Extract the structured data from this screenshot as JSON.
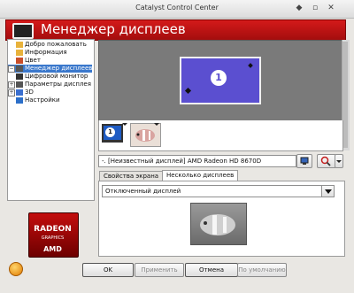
{
  "window": {
    "title": "Catalyst Control Center",
    "buttons": [
      "◆",
      "▫",
      "✕"
    ]
  },
  "header": {
    "title": "Менеджер дисплеев"
  },
  "tree": {
    "items": [
      {
        "label": "Добро пожаловать",
        "toggle": "",
        "icon_color": "#e8b23b"
      },
      {
        "label": "Информация",
        "toggle": "",
        "icon_color": "#e8b23b"
      },
      {
        "label": "Цвет",
        "toggle": "",
        "icon_color": "#c94e2a"
      },
      {
        "label": "Менеджер дисплеев",
        "toggle": "−",
        "icon_color": "#555555",
        "selected": true
      },
      {
        "label": "Цифровой монитор",
        "toggle": "",
        "icon_color": "#333333"
      },
      {
        "label": "Параметры дисплея",
        "toggle": "+",
        "icon_color": "#555555"
      },
      {
        "label": "3D",
        "toggle": "+",
        "icon_color": "#3a6fd0"
      },
      {
        "label": "Настройки",
        "toggle": "",
        "icon_color": "#2c6fc9"
      }
    ]
  },
  "amd": {
    "line1": "RADEON",
    "line2": "GRAPHICS",
    "line3": "AMD"
  },
  "stage": {
    "monitor_number": "1"
  },
  "thumbs": {
    "monitor_number": "1"
  },
  "info": {
    "text": "-. [Неизвестный дисплей] AMD Radeon HD 8670D"
  },
  "tabs": [
    {
      "label": "Свойства экрана",
      "active": false
    },
    {
      "label": "Несколько дисплеев",
      "active": true
    }
  ],
  "panel": {
    "combo_value": "Отключенный дисплей"
  },
  "buttons": {
    "ok": "OK",
    "apply": "Применить",
    "cancel": "Отмена",
    "default": "По умолчанию"
  },
  "colors": {
    "accent": "#c01414",
    "selection": "#3a78cc",
    "monitor": "#5b4fd0"
  }
}
